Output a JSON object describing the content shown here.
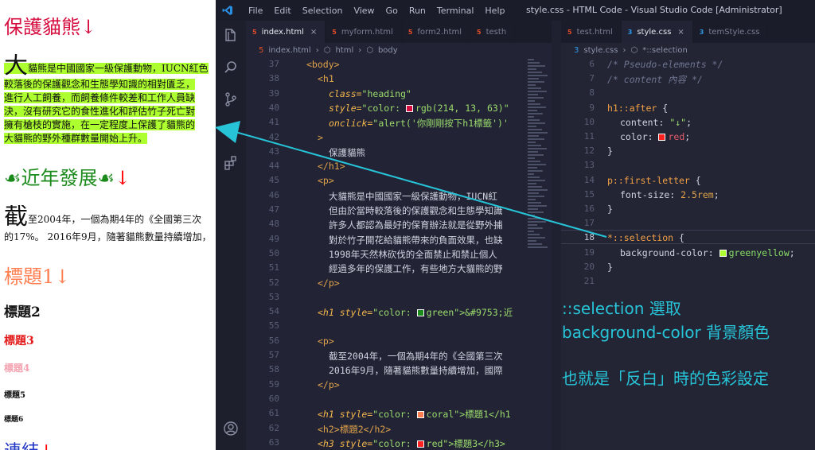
{
  "preview": {
    "h1_heading": "保護貓熊",
    "para1": {
      "first_letter": "大",
      "lines": [
        "貓熊是中國國家一級保護動物，IUCN紅色",
        "較落後的保護觀念和生態學知識的相對匱乏，",
        "進行人工飼養，而飼養條件較差和工作人員缺",
        "決，沒有研究它的食性進化和評估竹子死亡對",
        "擁有槍枝的實施，在一定程度上保護了貓熊的",
        "大貓熊的野外種群數量開始上升。"
      ]
    },
    "h1_green": {
      "icon_text": "☙",
      "text": "近年發展"
    },
    "para2": {
      "first_letter": "截",
      "line1": "至2004年，一個為期4年的《全國第三次",
      "line2": "的17%。 2016年9月，隨著貓熊數量持續增加，"
    },
    "h1_coral": "標題1",
    "h2": "標題2",
    "h3": "標題3",
    "h4": "標題4",
    "h5": "標題5",
    "h6": "標題6",
    "h1_last": "連結",
    "after_content": "↓"
  },
  "vscode": {
    "menu": [
      "File",
      "Edit",
      "Selection",
      "View",
      "Go",
      "Run",
      "Terminal",
      "Help"
    ],
    "title": "style.css - HTML Code - Visual Studio Code [Administrator]",
    "left_tabs": [
      {
        "label": "index.html",
        "close": "×"
      },
      {
        "label": "myform.html"
      },
      {
        "label": "form2.html"
      },
      {
        "label": "testh"
      }
    ],
    "right_tabs": [
      {
        "label": "test.html"
      },
      {
        "label": "style.css",
        "close": "×"
      },
      {
        "label": "temStyle.css"
      }
    ],
    "left_crumbs": [
      "index.html",
      "›",
      "html",
      "›",
      "body"
    ],
    "right_crumbs": [
      "style.css",
      "›",
      "*::selection"
    ],
    "left_code": [
      {
        "n": "37",
        "t": "<body>"
      },
      {
        "n": "38",
        "t": "<h1"
      },
      {
        "n": "39",
        "attr": "class=",
        "str": "\"heading\""
      },
      {
        "n": "40",
        "attr": "style=",
        "str": "\"color: ",
        "color": "rgb(214, 13, 63)",
        "end": "\""
      },
      {
        "n": "41",
        "attr": "onclick=",
        "str": "\"alert('你剛剛按下h1標籤')'"
      },
      {
        "n": "42",
        "t": ">"
      },
      {
        "n": "43",
        "t": "保護貓熊"
      },
      {
        "n": "44",
        "t": "</h1>"
      },
      {
        "n": "45",
        "t": "<p>"
      },
      {
        "n": "46",
        "t": "大貓熊是中國國家一級保護動物，IUCN紅"
      },
      {
        "n": "47",
        "t": "但由於當時較落後的保護觀念和生態學知識"
      },
      {
        "n": "48",
        "t": "許多人都認為最好的保育辦法就是從野外捕"
      },
      {
        "n": "49",
        "t": "對於竹子開花給貓熊帶來的負面效果，也缺"
      },
      {
        "n": "50",
        "t": "1998年天然林砍伐的全面禁止和禁止個人"
      },
      {
        "n": "51",
        "t": "經過多年的保護工作，有些地方大貓熊的野"
      },
      {
        "n": "52",
        "t": "</p>"
      },
      {
        "n": "53",
        "t": ""
      },
      {
        "n": "54",
        "attr": "<h1 style=",
        "str": "\"color: ",
        "color": "green",
        "end": "\">&#9753;近"
      },
      {
        "n": "55",
        "t": ""
      },
      {
        "n": "56",
        "t": "<p>"
      },
      {
        "n": "57",
        "t": "截至2004年，一個為期4年的《全國第三次"
      },
      {
        "n": "58",
        "t": "2016年9月，隨著貓熊數量持續增加，國際"
      },
      {
        "n": "59",
        "t": "</p>"
      },
      {
        "n": "60",
        "t": ""
      },
      {
        "n": "61",
        "attr": "<h1 style=",
        "str": "\"color: ",
        "color": "coral",
        "end": "\">標題1</h1"
      },
      {
        "n": "62",
        "t": "<h2>標題2</h2>"
      },
      {
        "n": "63",
        "attr": "<h3 style=",
        "str": "\"color: ",
        "color": "red",
        "end": "\">標題3</h3>"
      }
    ],
    "right_code": [
      {
        "n": "6",
        "com": "/* Pseudo-elements */"
      },
      {
        "n": "7",
        "com": "/* content 內容 */"
      },
      {
        "n": "8",
        "t": ""
      },
      {
        "n": "9",
        "sel": "h1::after",
        "t": " {"
      },
      {
        "n": "10",
        "prop": "content: ",
        "str": "\"↓\"",
        "end": ";"
      },
      {
        "n": "11",
        "prop": "color: ",
        "color": "red",
        "end": ";"
      },
      {
        "n": "12",
        "t": "}"
      },
      {
        "n": "13",
        "t": ""
      },
      {
        "n": "14",
        "sel": "p::first-letter",
        "t": " {"
      },
      {
        "n": "15",
        "prop": "font-size: ",
        "num": "2.5rem",
        "end": ";"
      },
      {
        "n": "16",
        "t": "}"
      },
      {
        "n": "17",
        "t": ""
      },
      {
        "n": "18",
        "sel": "*::selection",
        "t": " {"
      },
      {
        "n": "19",
        "prop": "background-color: ",
        "color": "greenyellow",
        "end": ";"
      },
      {
        "n": "20",
        "t": "}"
      },
      {
        "n": "21",
        "t": ""
      }
    ]
  },
  "annotation": {
    "line1": "::selection 選取",
    "line2": "background-color 背景顏色",
    "line3": "也就是「反白」時的色彩設定"
  },
  "colors": {
    "heading": "#d60d3f",
    "highlight": "#adff2f",
    "annotation": "#27c4d8",
    "editor_bg": "#222436"
  }
}
